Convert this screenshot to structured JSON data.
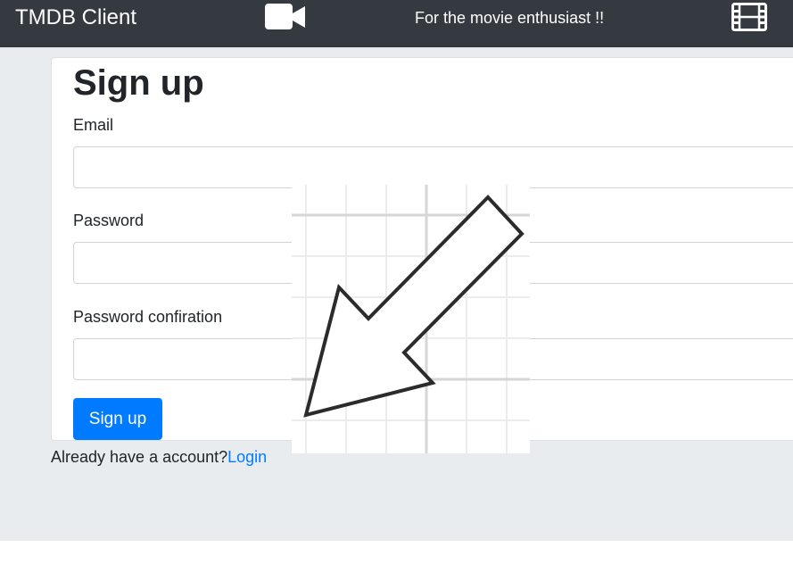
{
  "navbar": {
    "brand": "TMDB Client",
    "tagline": "For the movie enthusiast !!",
    "left_icon": "video-camera-icon",
    "right_icon": "film-strip-icon"
  },
  "signup": {
    "title": "Sign up",
    "email_label": "Email",
    "email_value": "",
    "password_label": "Password",
    "password_value": "",
    "password_confirmation_label": "Password confiration",
    "password_confirmation_value": "",
    "submit_label": "Sign up"
  },
  "footer": {
    "account_prompt": "Already have a account?",
    "login_link": "Login"
  },
  "overlay": {
    "icon": "arrow-down-left-icon"
  },
  "colors": {
    "navbar_bg": "#343a40",
    "page_bg": "#e9ecef",
    "primary": "#007bff",
    "text": "#212529"
  }
}
